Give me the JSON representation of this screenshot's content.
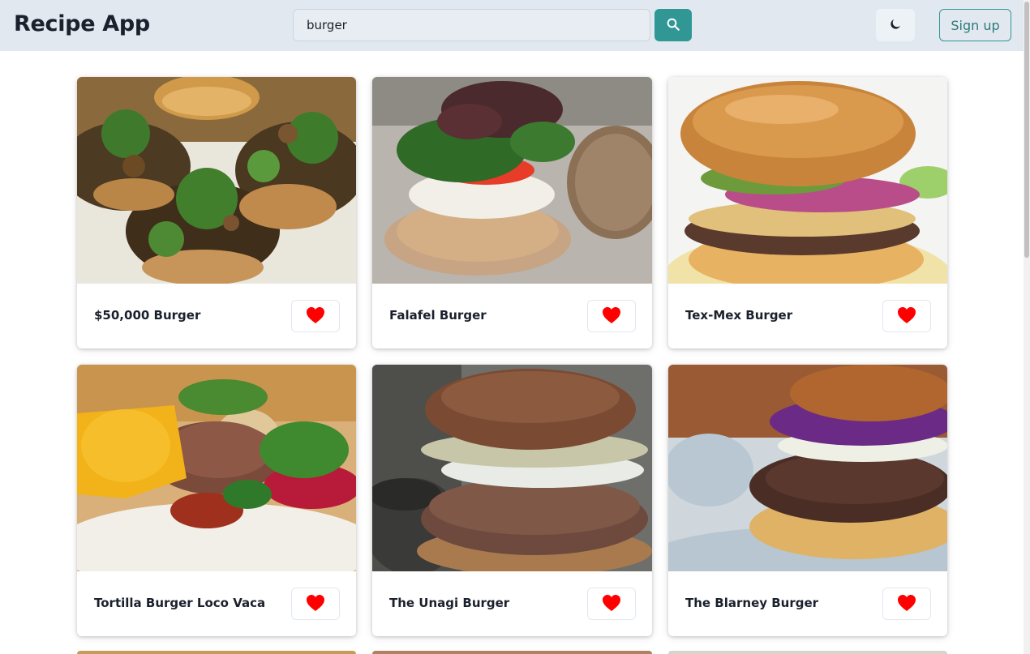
{
  "app": {
    "title": "Recipe App"
  },
  "search": {
    "value": "burger",
    "icon": "search-icon"
  },
  "header": {
    "theme_icon": "moon-icon",
    "signup_label": "Sign up"
  },
  "colors": {
    "header_bg": "#e2e8f0",
    "accent": "#319795",
    "heart": "#ff0000"
  },
  "recipes": [
    {
      "title": "$50,000 Burger"
    },
    {
      "title": "Falafel Burger"
    },
    {
      "title": "Tex-Mex Burger"
    },
    {
      "title": "Tortilla Burger Loco Vaca"
    },
    {
      "title": "The Unagi Burger"
    },
    {
      "title": "The Blarney Burger"
    }
  ]
}
